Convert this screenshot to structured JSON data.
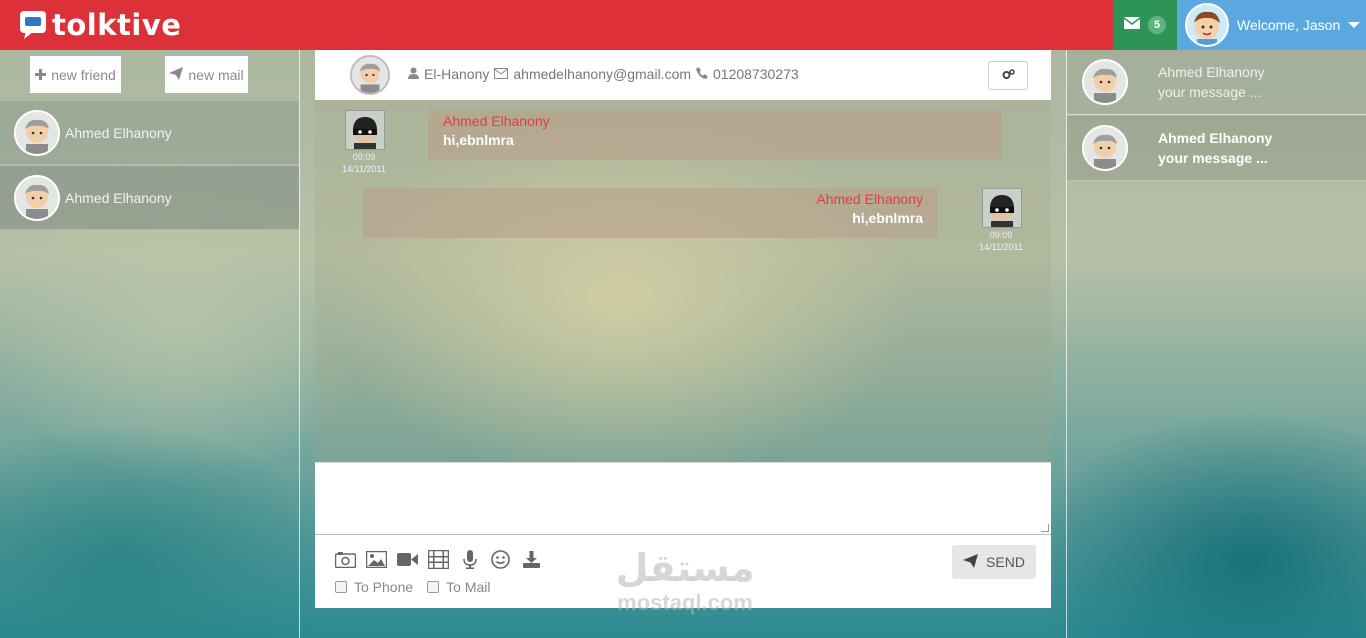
{
  "app": {
    "logo_text": "tolktive",
    "brand_color": "#dc3139"
  },
  "header": {
    "mail_count": "5",
    "welcome": "Welcome, Jason",
    "icons": [
      "envelope-icon",
      "chevron-down-icon"
    ]
  },
  "left_panel": {
    "new_friend_label": "new friend",
    "new_mail_label": "new mail",
    "friends": [
      {
        "name": "Ahmed Elhanony"
      },
      {
        "name": "Ahmed Elhanony"
      }
    ]
  },
  "chat": {
    "contact_name": "El-Hanony",
    "contact_email": "ahmedelhanony@gmail.com",
    "contact_phone": "01208730273",
    "messages": [
      {
        "sender": "Ahmed Elhanony",
        "text": "hi,ebnlmra",
        "time": "09:09",
        "date": "14/11/2011",
        "side": "left"
      },
      {
        "sender": "Ahmed Elhanony",
        "text": "hi,ebnlmra",
        "time": "09:09",
        "date": "14/11/2011",
        "side": "right"
      }
    ],
    "compose_value": "",
    "tools": [
      "camera-icon",
      "image-icon",
      "video-icon",
      "film-icon",
      "microphone-icon",
      "smiley-icon",
      "download-icon"
    ],
    "to_phone_label": "To Phone",
    "to_mail_label": "To Mail",
    "send_label": "SEND"
  },
  "right_panel": {
    "conversations": [
      {
        "name": "Ahmed Elhanony",
        "preview": "your message ..."
      },
      {
        "name": "Ahmed Elhanony",
        "preview": "your message ..."
      }
    ]
  },
  "watermark": {
    "arabic": "مستقل",
    "latin": "mostaql.com"
  }
}
